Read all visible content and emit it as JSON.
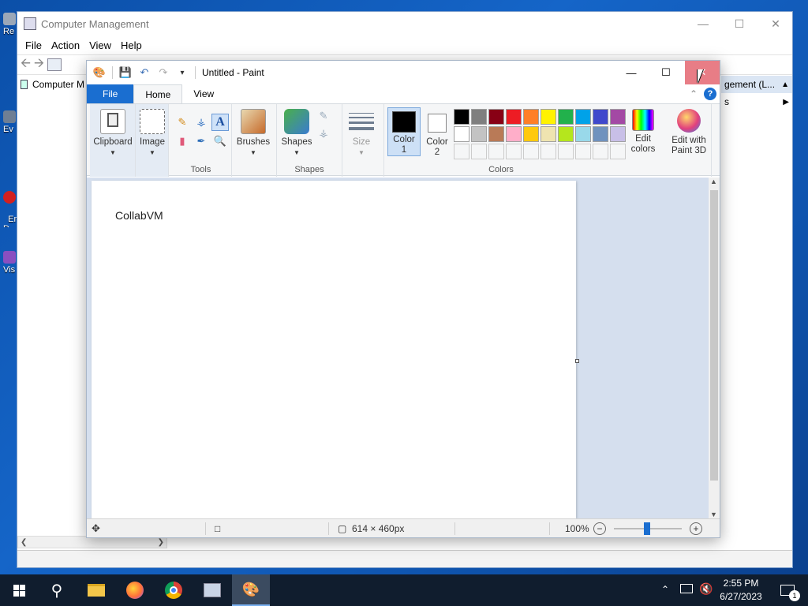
{
  "desktop": {
    "icons": [
      "Re",
      "Ev",
      "Em\nD",
      "Vis"
    ]
  },
  "cm": {
    "title": "Computer Management",
    "menu": [
      "File",
      "Action",
      "View",
      "Help"
    ],
    "tree_item": "Computer M",
    "actions_header": "gement (L...",
    "actions_item": "s"
  },
  "paint": {
    "title": "Untitled - Paint",
    "tabs": {
      "file": "File",
      "home": "Home",
      "view": "View"
    },
    "groups": {
      "clipboard": "Clipboard",
      "image": "Image",
      "tools": "Tools",
      "brushes": "Brushes",
      "shapes": "Shapes",
      "shapes_group": "Shapes",
      "size": "Size",
      "color1": "Color 1",
      "color2": "Color 2",
      "colors": "Colors",
      "edit_colors": "Edit colors",
      "edit_paint3d": "Edit with Paint 3D"
    },
    "palette": [
      "#000000",
      "#7f7f7f",
      "#880015",
      "#ed1c24",
      "#ff7f27",
      "#fff200",
      "#22b14c",
      "#00a2e8",
      "#3f48cc",
      "#a349a4",
      "#ffffff",
      "#c3c3c3",
      "#b97a57",
      "#ffaec9",
      "#ffc90e",
      "#efe4b0",
      "#b5e61d",
      "#99d9ea",
      "#7092be",
      "#c8bfe7",
      "#f5f6f7",
      "#f5f6f7",
      "#f5f6f7",
      "#f5f6f7",
      "#f5f6f7",
      "#f5f6f7",
      "#f5f6f7",
      "#f5f6f7",
      "#f5f6f7",
      "#f5f6f7"
    ],
    "color1_value": "#000000",
    "color2_value": "#ffffff",
    "canvas_text": "CollabVM",
    "status": {
      "dimensions": "614 × 460px",
      "zoom": "100%"
    }
  },
  "taskbar": {
    "time": "2:55 PM",
    "date": "6/27/2023",
    "notification_count": "1"
  }
}
